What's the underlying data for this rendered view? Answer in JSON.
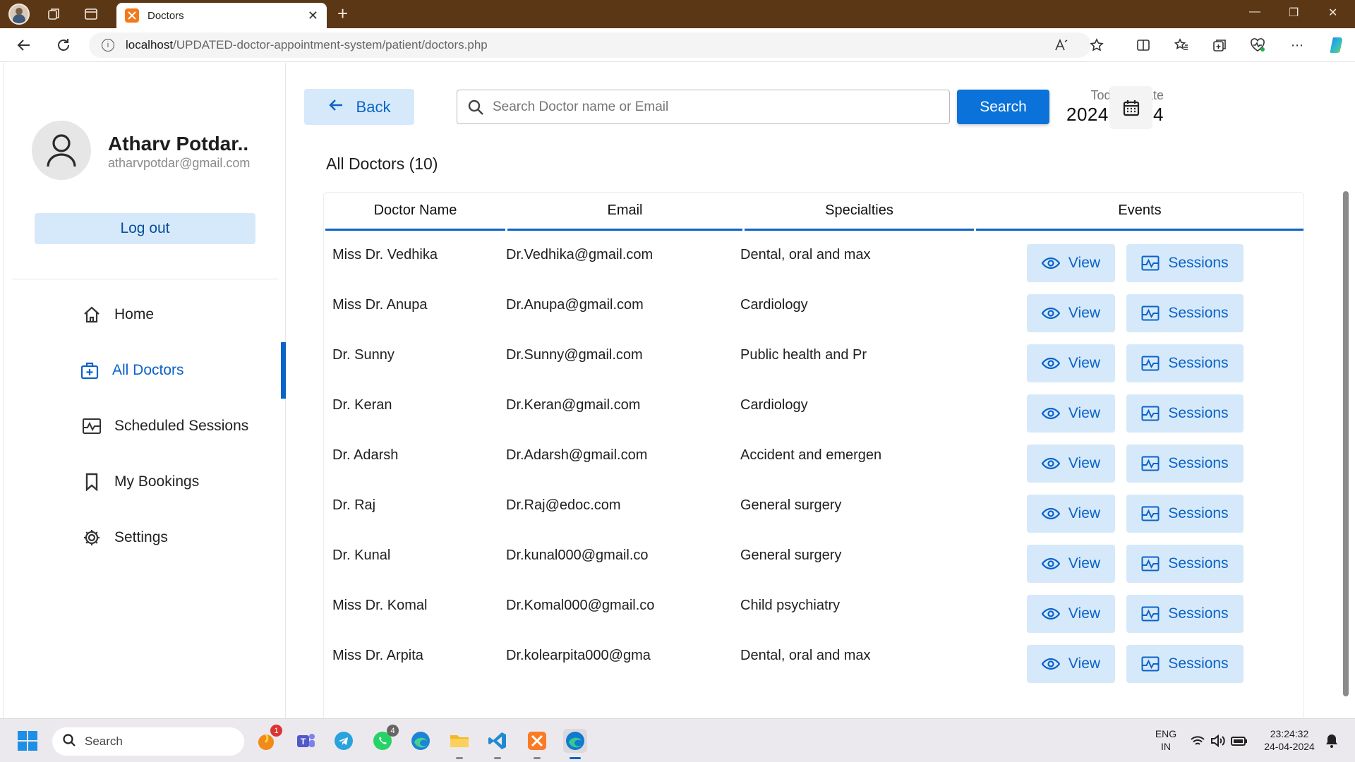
{
  "browser": {
    "tab_title": "Doctors",
    "url_host": "localhost",
    "url_path": "/UPDATED-doctor-appointment-system/patient/doctors.php"
  },
  "sidebar": {
    "user_name": "Atharv Potdar..",
    "user_email": "atharvpotdar@gmail.com",
    "logout_label": "Log out",
    "items": [
      {
        "label": "Home",
        "icon": "home-icon"
      },
      {
        "label": "All Doctors",
        "icon": "medical-bag-icon",
        "active": true
      },
      {
        "label": "Scheduled Sessions",
        "icon": "sessions-icon"
      },
      {
        "label": "My Bookings",
        "icon": "bookmark-icon"
      },
      {
        "label": "Settings",
        "icon": "gear-icon"
      }
    ]
  },
  "header": {
    "back_label": "Back",
    "search_placeholder": "Search Doctor name or Email",
    "search_label": "Search",
    "date_label": "Today's Date",
    "date_value": "2024-04-24"
  },
  "section_title": "All Doctors (10)",
  "table": {
    "columns": [
      "Doctor Name",
      "Email",
      "Specialties",
      "Events"
    ],
    "view_label": "View",
    "sessions_label": "Sessions",
    "rows": [
      {
        "name": "Miss Dr. Vedhika",
        "email": "Dr.Vedhika@gmail.com",
        "specialty": "Dental, oral and max"
      },
      {
        "name": "Miss Dr. Anupa",
        "email": "Dr.Anupa@gmail.com",
        "specialty": "Cardiology"
      },
      {
        "name": "Dr. Sunny",
        "email": "Dr.Sunny@gmail.com",
        "specialty": "Public health and Pr"
      },
      {
        "name": "Dr. Keran",
        "email": "Dr.Keran@gmail.com",
        "specialty": "Cardiology"
      },
      {
        "name": "Dr. Adarsh",
        "email": "Dr.Adarsh@gmail.com",
        "specialty": "Accident and emergen"
      },
      {
        "name": "Dr. Raj",
        "email": "Dr.Raj@edoc.com",
        "specialty": "General surgery"
      },
      {
        "name": "Dr. Kunal",
        "email": "Dr.kunal000@gmail.co",
        "specialty": "General surgery"
      },
      {
        "name": "Miss Dr. Komal",
        "email": "Dr.Komal000@gmail.co",
        "specialty": "Child psychiatry"
      },
      {
        "name": "Miss Dr. Arpita",
        "email": "Dr.kolearpita000@gma",
        "specialty": "Dental, oral and max"
      }
    ]
  },
  "taskbar": {
    "search_label": "Search",
    "lang_top": "ENG",
    "lang_bottom": "IN",
    "time": "23:24:32",
    "date": "24-04-2024",
    "badges": {
      "orange_app": "1",
      "whatsapp": "4"
    }
  },
  "colors": {
    "accent": "#0a63c9",
    "button_bg": "#d6e9fa",
    "titlebar": "#5b3716"
  }
}
